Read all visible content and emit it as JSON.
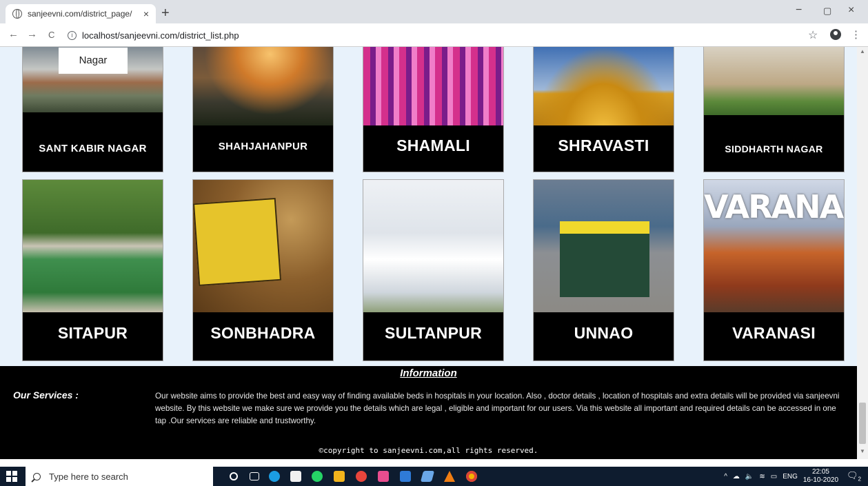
{
  "browser": {
    "tab_title": "sanjeevni.com/district_page/",
    "tab_close": "×",
    "new_tab": "+",
    "url": "localhost/sanjeevni.com/district_list.php",
    "back": "←",
    "forward": "→",
    "reload": "C",
    "info": "i",
    "star": "☆",
    "kebab": "⋮",
    "minimize": "−",
    "maximize": "▢",
    "close": "×"
  },
  "districts_row1": [
    {
      "name": "SANT KABIR NAGAR",
      "image_caption": "Nagar",
      "icon": "landscape-photo"
    },
    {
      "name": "SHAHJAHANPUR",
      "icon": "landscape-photo"
    },
    {
      "name": "SHAMALI",
      "icon": "landscape-photo"
    },
    {
      "name": "SHRAVASTI",
      "icon": "landscape-photo"
    },
    {
      "name": "SIDDHARTH NAGAR",
      "icon": "landscape-photo"
    }
  ],
  "districts_row2": [
    {
      "name": "SITAPUR",
      "icon": "landscape-photo"
    },
    {
      "name": "SONBHADRA",
      "icon": "landscape-photo"
    },
    {
      "name": "SULTANPUR",
      "icon": "landscape-photo"
    },
    {
      "name": "UNNAO",
      "icon": "landscape-photo"
    },
    {
      "name": "VARANASI",
      "image_caption": "VARANASI",
      "icon": "landscape-photo"
    }
  ],
  "footer": {
    "info_title": "Information",
    "services_label": "Our Services :",
    "services_text": "Our website aims to provide the best and easy way of finding available beds in hospitals in your location. Also , doctor details , location of hospitals and extra details will be provided via sanjeevni website. By this website we make sure we provide you the details which are legal , eligible and important for our users. Via this website all important and required details can be accessed in one tap .Our services are reliable and trustworthy.",
    "copyright": "©copyright to sanjeevni.com,all rights reserved."
  },
  "taskbar": {
    "search_placeholder": "Type here to search",
    "lang": "ENG",
    "time": "22:05",
    "date": "16-10-2020",
    "notification_count": "2",
    "accent": "#0e1c2f"
  }
}
